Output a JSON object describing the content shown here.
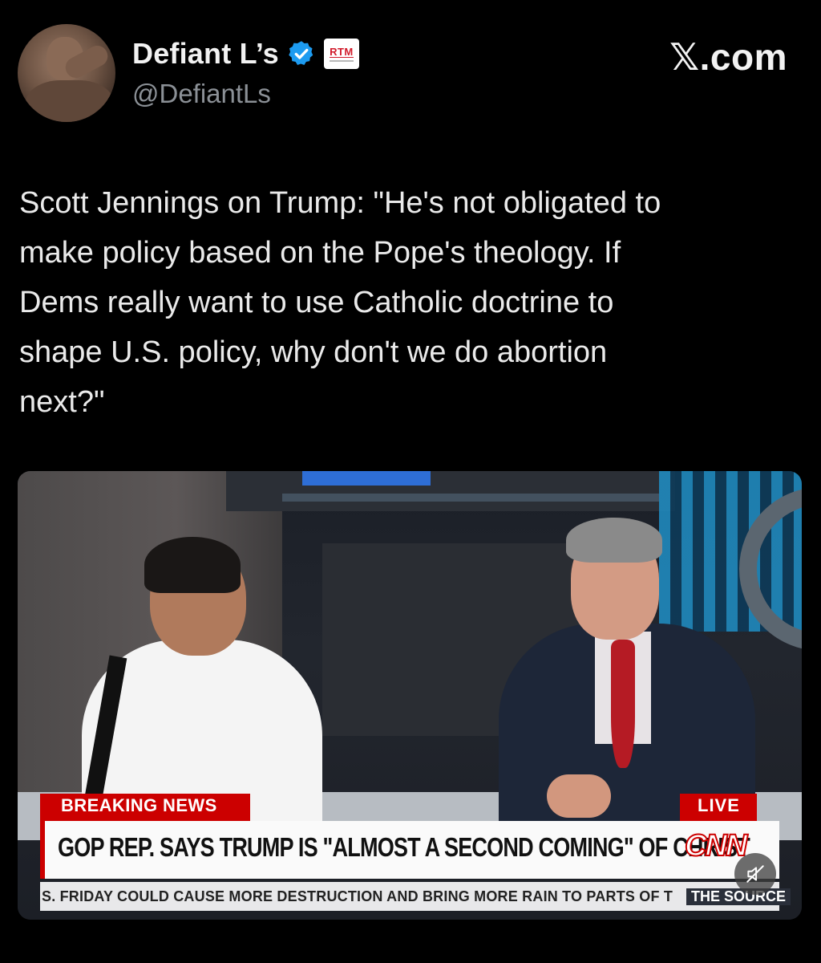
{
  "header": {
    "display_name": "Defiant L’s",
    "handle": "@DefiantLs",
    "brand": "𝕏.com",
    "affiliate_badge": "RTM",
    "verified_icon": "verified-badge-icon"
  },
  "tweet": {
    "text": "Scott Jennings on Trump: \"He's not obligated to\nmake policy based on the Pope's theology. If\nDems really want to use Catholic doctrine to\nshape U.S. policy, why don't we do abortion\nnext?\""
  },
  "video": {
    "breaking_label": "BREAKING NEWS",
    "live_label": "LIVE",
    "headline": "GOP REP. SAYS TRUMP IS \"ALMOST A SECOND COMING\" OF CHRIST",
    "network_logo": "CNN",
    "ticker": "S. FRIDAY COULD CAUSE MORE DESTRUCTION AND BRING MORE RAIN TO PARTS OF T",
    "ticker_source": "THE SOURCE",
    "mute_icon": "muted-speaker-icon"
  },
  "colors": {
    "background": "#000000",
    "verified_blue": "#1d9bf0",
    "cnn_red": "#cc0000"
  }
}
